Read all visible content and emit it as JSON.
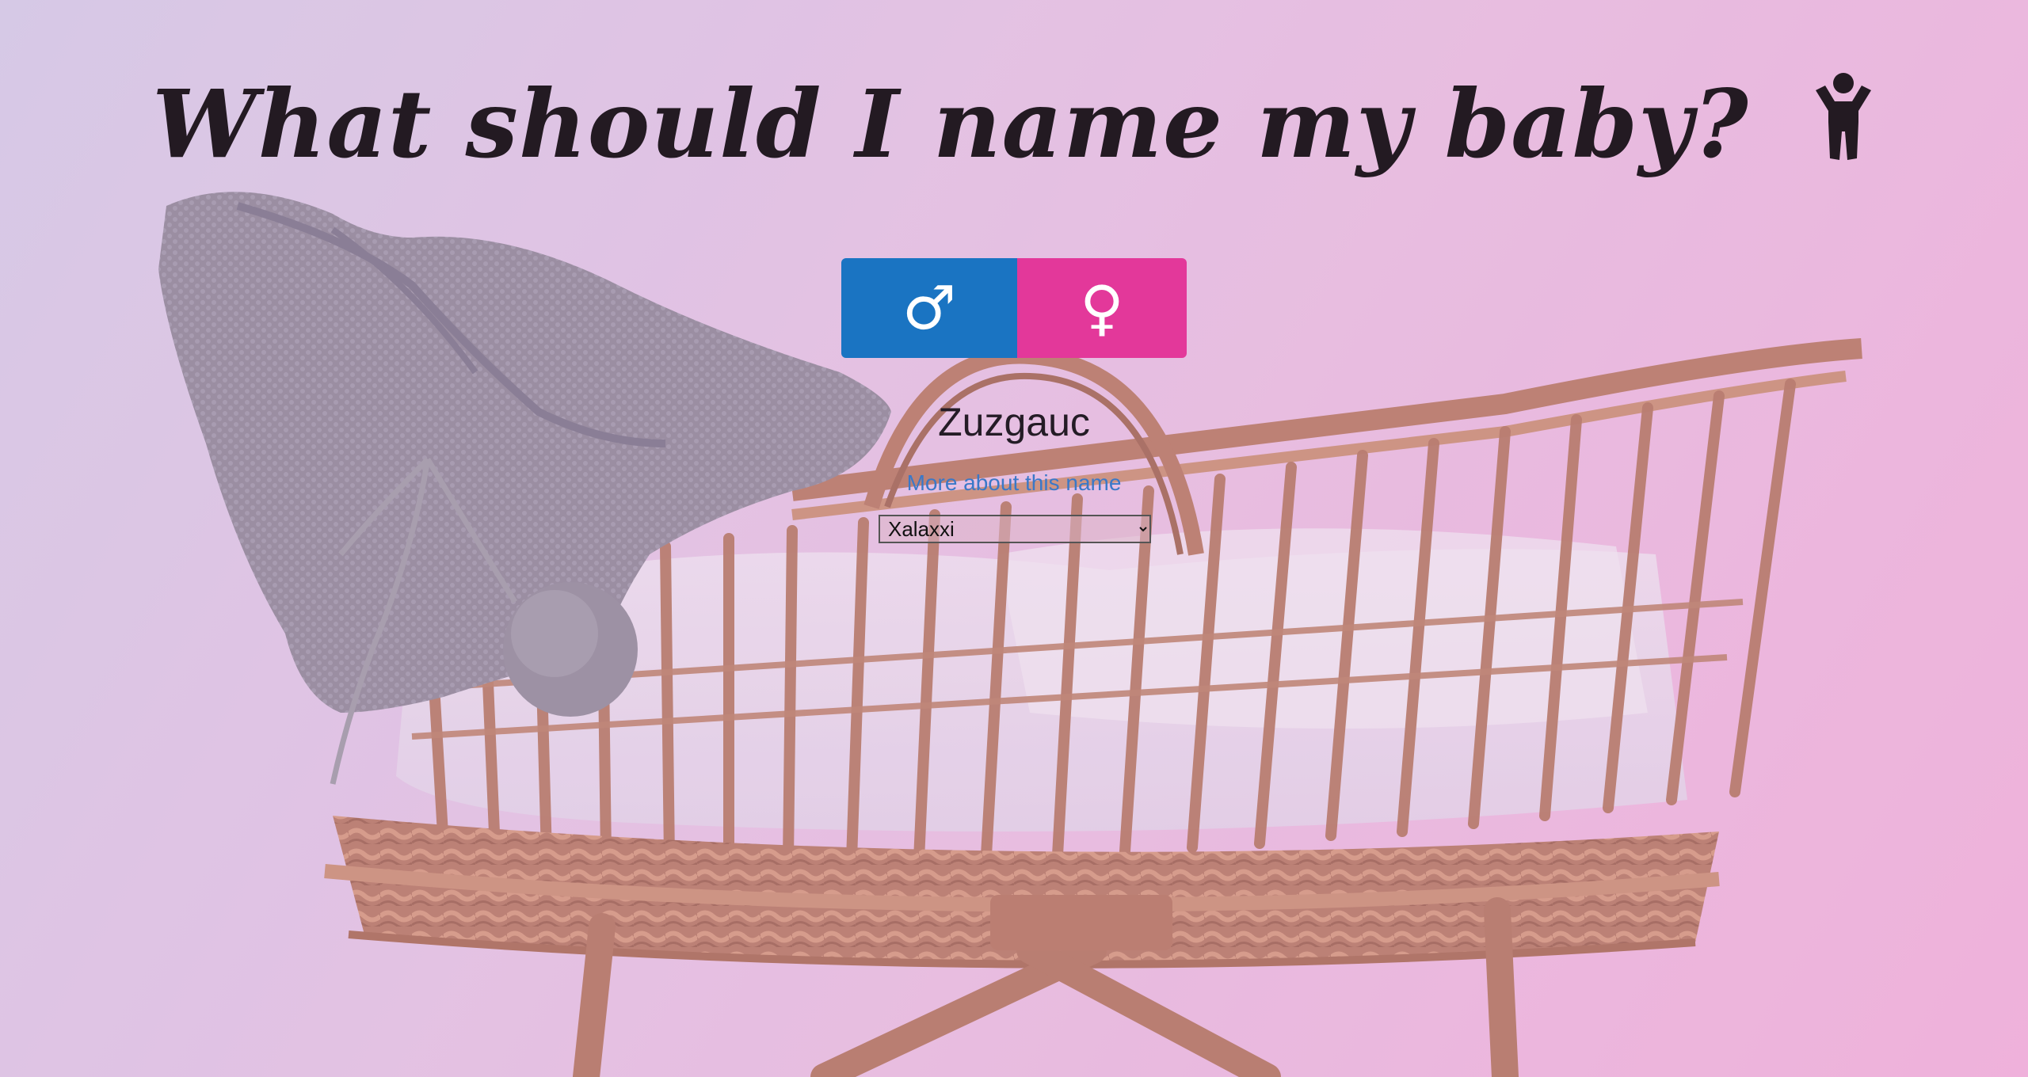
{
  "header": {
    "title": "What should I name my baby?",
    "icon": "child-icon"
  },
  "gender": {
    "male": {
      "label": "♂",
      "icon": "male-symbol-icon",
      "color": "#1a74c2"
    },
    "female": {
      "label": "♀",
      "icon": "female-symbol-icon",
      "color": "#e3389a"
    }
  },
  "result": {
    "name": "Zuzgauc",
    "more_link": "More about this name"
  },
  "language_select": {
    "selected": "Xalaxxi"
  },
  "colors": {
    "background_start": "#d4cbe7",
    "background_end": "#f2aed9",
    "title_color": "#231a22",
    "link_color": "#3a78c8"
  }
}
